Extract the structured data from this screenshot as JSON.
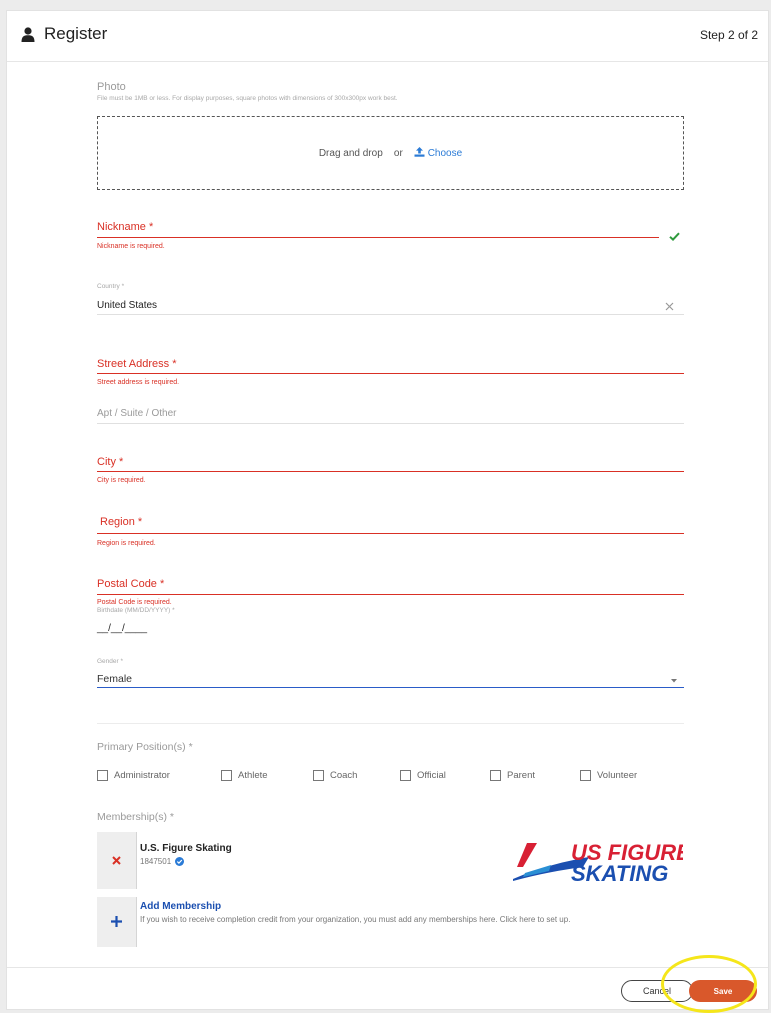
{
  "header": {
    "title": "Register",
    "step": "Step 2 of 2",
    "icon": "user-icon"
  },
  "photo": {
    "label": "Photo",
    "hint": "File must be 1MB or less. For display purposes, square photos with dimensions of 300x300px work best.",
    "drag_text": "Drag and drop",
    "or_text": "or",
    "choose_label": "Choose",
    "upload_icon": "upload-icon"
  },
  "nickname": {
    "label": "Nickname *",
    "error": "Nickname is required."
  },
  "country": {
    "label": "Country *",
    "value": "United States",
    "clear_icon": "close-icon"
  },
  "street": {
    "label": "Street Address *",
    "error": "Street address is required."
  },
  "apt": {
    "placeholder": "Apt / Suite / Other"
  },
  "city": {
    "label": "City *",
    "error": "City is required."
  },
  "region": {
    "label": "Region *",
    "error": "Region is required."
  },
  "postal": {
    "label": "Postal Code *",
    "error": "Postal Code is required."
  },
  "birthdate": {
    "label": "Birthdate (MM/DD/YYYY) *",
    "value": "__/__/____"
  },
  "gender": {
    "label": "Gender *",
    "value": "Female"
  },
  "positions": {
    "label": "Primary Position(s) *",
    "options": [
      "Administrator",
      "Athlete",
      "Coach",
      "Official",
      "Parent",
      "Volunteer"
    ]
  },
  "memberships": {
    "label": "Membership(s) *",
    "items": [
      {
        "name": "U.S. Figure Skating",
        "id": "1847501",
        "logo_line1": "US FIGURE",
        "logo_line2": "SKATING"
      }
    ],
    "add": {
      "title": "Add Membership",
      "description": "If you wish to receive completion credit from your organization, you must add any memberships here. Click here to set up."
    }
  },
  "footer": {
    "cancel_label": "Cancel",
    "save_label": "Save"
  },
  "colors": {
    "error": "#d93025",
    "accent_blue": "#2b7bd6",
    "save_bg": "#d9582b",
    "highlight": "#f5e61a",
    "check_green": "#2e9a3c"
  }
}
